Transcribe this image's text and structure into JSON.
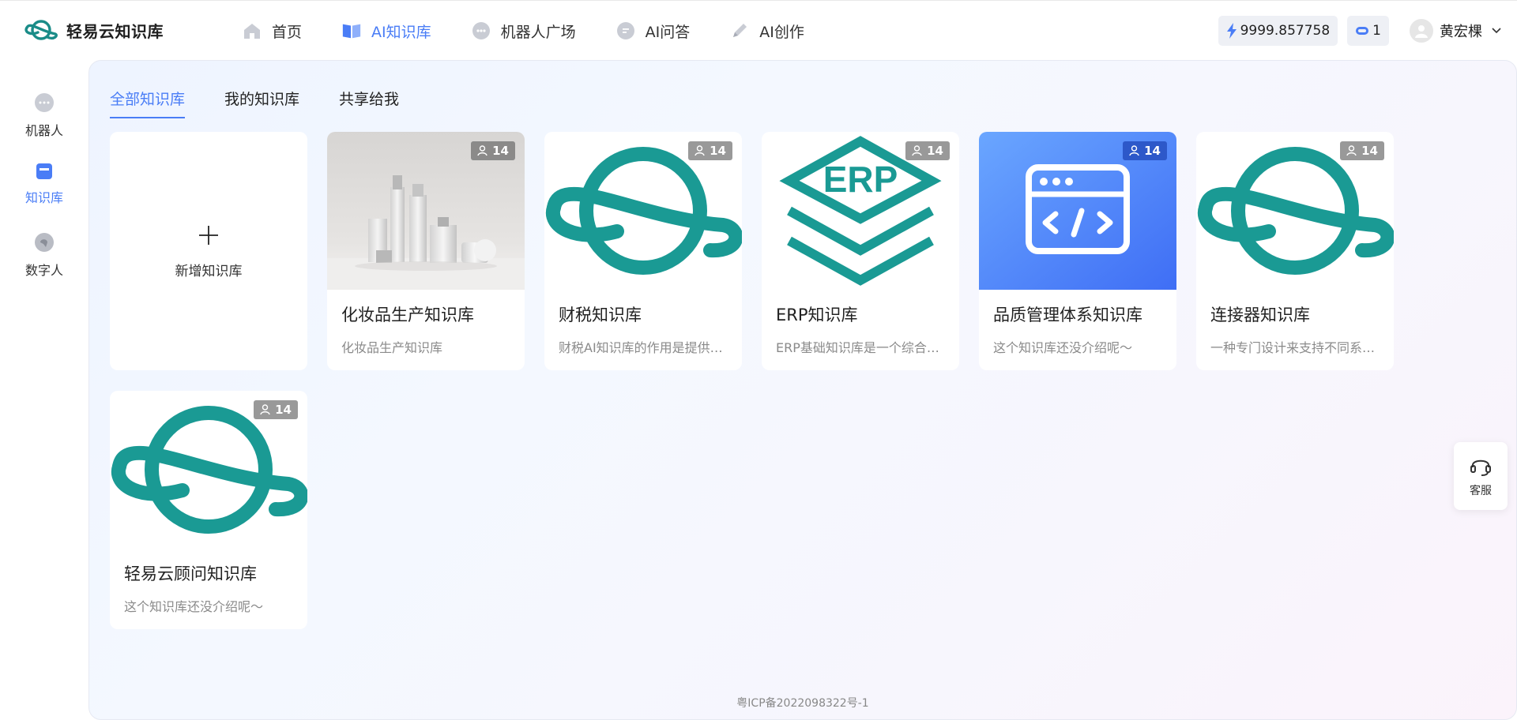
{
  "brand": {
    "name": "轻易云知识库",
    "logo_icon": "planet-ring-logo"
  },
  "nav": [
    {
      "label": "首页",
      "icon": "home-icon",
      "active": false
    },
    {
      "label": "AI知识库",
      "icon": "book-icon",
      "active": true
    },
    {
      "label": "机器人广场",
      "icon": "robot-icon",
      "active": false
    },
    {
      "label": "AI问答",
      "icon": "chat-icon",
      "active": false
    },
    {
      "label": "AI创作",
      "icon": "pen-icon",
      "active": false
    }
  ],
  "header_right": {
    "balance": "9999.857758",
    "tokens": "1",
    "user_name": "黄宏棵"
  },
  "sidebar": [
    {
      "label": "机器人",
      "icon": "robot-icon",
      "active": false
    },
    {
      "label": "知识库",
      "icon": "library-icon",
      "active": true
    },
    {
      "label": "数字人",
      "icon": "digital-human-icon",
      "active": false
    }
  ],
  "tabs": [
    {
      "label": "全部知识库",
      "active": true
    },
    {
      "label": "我的知识库",
      "active": false
    },
    {
      "label": "共享给我",
      "active": false
    }
  ],
  "add_card": {
    "label": "新增知识库"
  },
  "cards": [
    {
      "title": "化妆品生产知识库",
      "desc": "化妆品生产知识库",
      "members": "14",
      "thumb": "cosmetics-photo"
    },
    {
      "title": "财税知识库",
      "desc": "财税AI知识库的作用是提供专业的财税知识",
      "members": "14",
      "thumb": "logo"
    },
    {
      "title": "ERP知识库",
      "desc": "ERP基础知识库是一个综合性的资料集合",
      "members": "14",
      "thumb": "erp"
    },
    {
      "title": "品质管理体系知识库",
      "desc": "这个知识库还没介绍呢～",
      "members": "14",
      "thumb": "code-window"
    },
    {
      "title": "连接器知识库",
      "desc": "一种专门设计来支持不同系统之间的连接",
      "members": "14",
      "thumb": "logo"
    },
    {
      "title": "轻易云顾问知识库",
      "desc": "这个知识库还没介绍呢～",
      "members": "14",
      "thumb": "logo"
    }
  ],
  "footer": {
    "icp": "粤ICP备2022098322号-1"
  },
  "service": {
    "label": "客服"
  },
  "colors": {
    "accent": "#4a7df6",
    "teal": "#1a9a94"
  }
}
